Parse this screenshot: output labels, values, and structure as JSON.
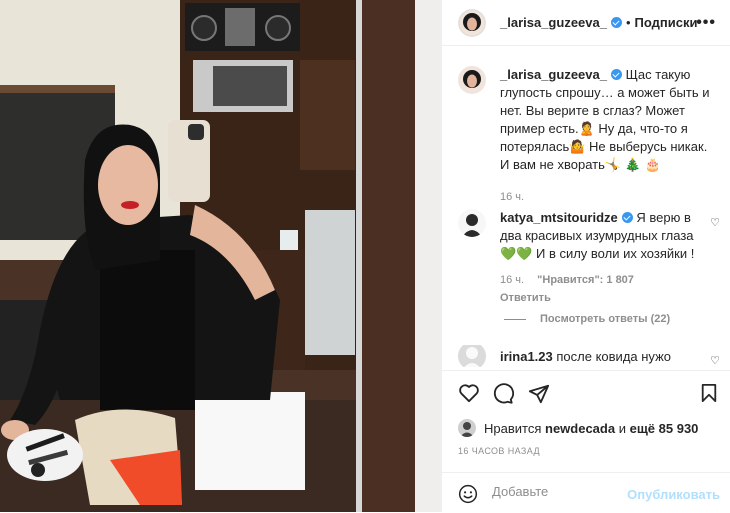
{
  "post": {
    "username": "_larisa_guzeeva_",
    "separator": "•",
    "follow_label": "Подписки",
    "more_label": "•••"
  },
  "caption": {
    "username": "_larisa_guzeeva_",
    "text": "Щас такую глупость спрошу… а может быть и нет. Вы верите в сглаз? Может пример есть.🙎 Ну да, что-то я потерялась🤷 Не выберусь никак. И вам не хворать🤸 🎄 🎂",
    "time": "16 ч."
  },
  "comments": [
    {
      "username": "katya_mtsitouridze",
      "text": "Я верю в два красивых изумрудных глаза 💚💚 И в силу воли их хозяйки !",
      "time": "16 ч.",
      "likes": "\"Нравится\": 1 807",
      "reply_label": "Ответить",
      "view_replies": "Посмотреть ответы (22)"
    },
    {
      "username": "irina1.23",
      "text": "после ковида нужо"
    }
  ],
  "likes_line": {
    "prefix": "Нравится",
    "user": "newdecada",
    "connector": "и",
    "rest": "ещё 85 930"
  },
  "post_time": "16 ЧАСОВ НАЗАД",
  "add_comment": {
    "placeholder": "Добавьте",
    "publish_label": "Опубликовать"
  },
  "colors": {
    "verified": "#3897f0",
    "publish_disabled": "#b2dffc",
    "meta_gray": "#8e8e8e"
  }
}
